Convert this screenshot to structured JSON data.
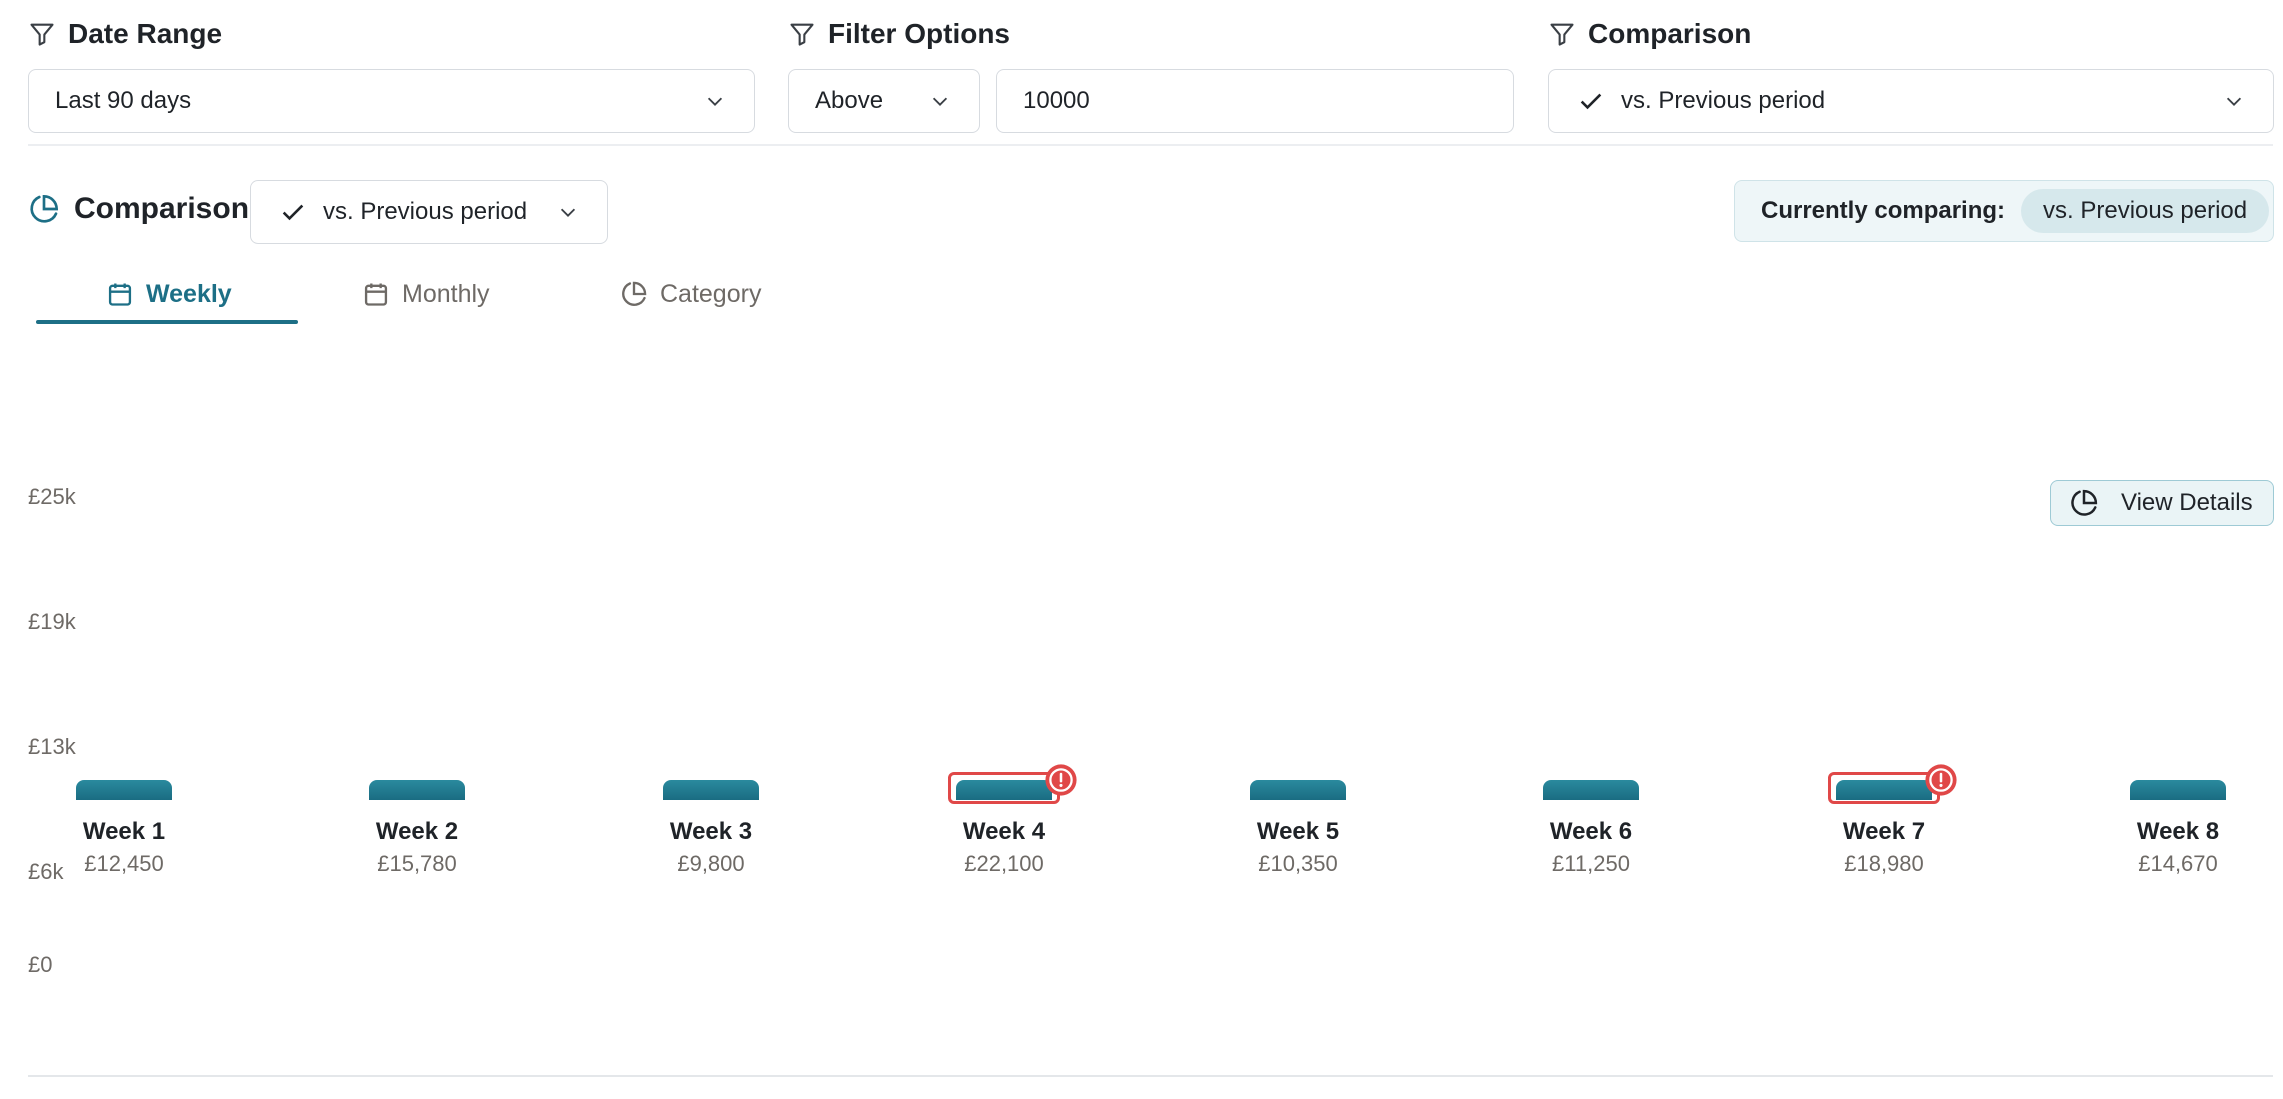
{
  "filters": {
    "date_range": {
      "title": "Date Range",
      "value": "Last 90 days"
    },
    "filter_options": {
      "title": "Filter Options",
      "operator": "Above",
      "value": "10000"
    },
    "comparison": {
      "title": "Comparison",
      "value": "vs. Previous period"
    }
  },
  "comparison_section": {
    "title": "Comparison",
    "select_value": "vs. Previous period",
    "currently_comparing_label": "Currently comparing:",
    "currently_comparing_value": "vs. Previous period"
  },
  "tabs": [
    {
      "label": "Weekly",
      "active": true
    },
    {
      "label": "Monthly",
      "active": false
    },
    {
      "label": "Category",
      "active": false
    }
  ],
  "view_details_label": "View Details",
  "colors": {
    "accent": "#1d6f86",
    "bar": "#1a6c82",
    "alert": "#e04848"
  },
  "chart_data": {
    "type": "bar",
    "y_ticks": [
      "£25k",
      "£19k",
      "£13k",
      "£6k",
      "£0"
    ],
    "categories": [
      "Week 1",
      "Week 2",
      "Week 3",
      "Week 4",
      "Week 5",
      "Week 6",
      "Week 7",
      "Week 8"
    ],
    "value_labels": [
      "£12,450",
      "£15,780",
      "£9,800",
      "£22,100",
      "£10,350",
      "£11,250",
      "£18,980",
      "£14,670"
    ],
    "values": [
      12450,
      15780,
      9800,
      22100,
      10350,
      11250,
      18980,
      14670
    ],
    "flagged": [
      false,
      false,
      false,
      true,
      false,
      false,
      true,
      false
    ]
  }
}
